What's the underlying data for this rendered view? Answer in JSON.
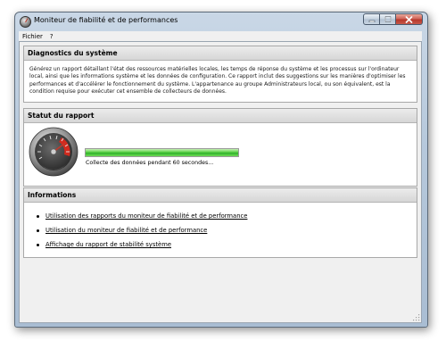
{
  "window": {
    "title": "Moniteur de fiabilité et de performances"
  },
  "menu": {
    "items": [
      "Fichier",
      "?"
    ]
  },
  "diagnostics": {
    "header": "Diagnostics du système",
    "description": "Générez un rapport détaillant l'état des ressources matérielles locales, les temps de réponse du système et les processus sur l'ordinateur local, ainsi que les informations système et les données de configuration. Ce rapport inclut des suggestions sur les manières d'optimiser les performances et d'accélérer le fonctionnement du système. L'appartenance au groupe Administrateurs local, ou son équivalent, est la condition requise pour exécuter cet ensemble de collecteurs de données."
  },
  "status": {
    "header": "Statut du rapport",
    "progress_fraction": 1.0,
    "progress_text": "Collecte des données pendant 60 secondes...",
    "icon": "gauge-icon"
  },
  "informations": {
    "header": "Informations",
    "links": [
      "Utilisation des rapports du moniteur de fiabilité et de performance",
      "Utilisation du moniteur de fiabilité et de performance",
      "Affichage du rapport de stabilité système"
    ]
  },
  "colors": {
    "progress_green": "#3cc234",
    "panel_header": "#d9d9d9",
    "close_red": "#c7473a"
  }
}
